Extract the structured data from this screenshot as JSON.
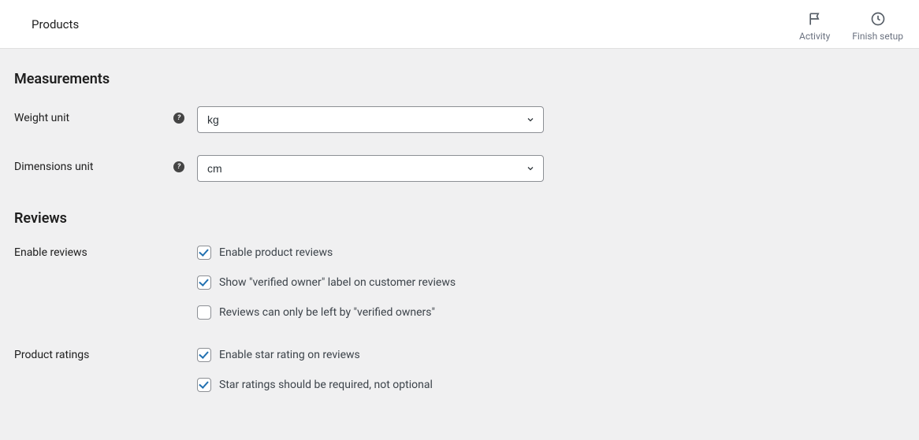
{
  "header": {
    "title": "Products",
    "actions": {
      "activity": "Activity",
      "finish_setup": "Finish setup"
    }
  },
  "sections": {
    "measurements": {
      "title": "Measurements",
      "weight_unit": {
        "label": "Weight unit",
        "value": "kg"
      },
      "dimensions_unit": {
        "label": "Dimensions unit",
        "value": "cm"
      }
    },
    "reviews": {
      "title": "Reviews",
      "enable_reviews": {
        "label": "Enable reviews",
        "options": {
          "enable_product_reviews": {
            "label": "Enable product reviews",
            "checked": true
          },
          "verified_owner_label": {
            "label": "Show \"verified owner\" label on customer reviews",
            "checked": true
          },
          "verified_owner_only": {
            "label": "Reviews can only be left by \"verified owners\"",
            "checked": false
          }
        }
      },
      "product_ratings": {
        "label": "Product ratings",
        "options": {
          "enable_star_rating": {
            "label": "Enable star rating on reviews",
            "checked": true
          },
          "star_rating_required": {
            "label": "Star ratings should be required, not optional",
            "checked": true
          }
        }
      }
    }
  }
}
